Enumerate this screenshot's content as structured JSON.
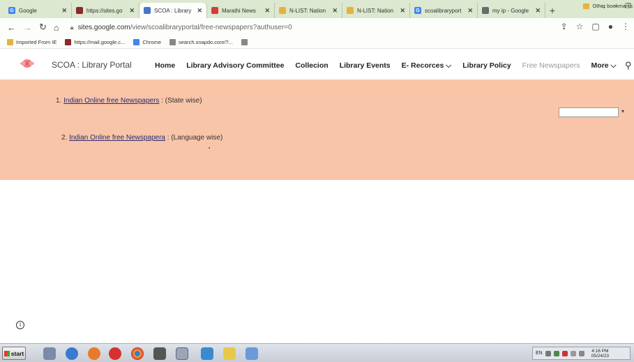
{
  "browser": {
    "tabs": [
      {
        "title": "Google",
        "icon": "google-icon",
        "color": "#4285f4",
        "glyph": "G",
        "active": false
      },
      {
        "title": "https://sites.go",
        "icon": "library-logo-icon",
        "color": "#8b2a2a",
        "glyph": "",
        "active": false
      },
      {
        "title": "SCOA : Library",
        "icon": "google-sites-icon",
        "color": "#4a76c9",
        "glyph": "",
        "active": true
      },
      {
        "title": "Marathi News",
        "icon": "news-icon",
        "color": "#d83a3a",
        "glyph": "",
        "active": false
      },
      {
        "title": "N-LIST: Nation",
        "icon": "nlist-icon",
        "color": "#e8b23a",
        "glyph": "",
        "active": false
      },
      {
        "title": "N-LIST: Nation",
        "icon": "nlist-icon",
        "color": "#e8b23a",
        "glyph": "",
        "active": false
      },
      {
        "title": "scoalibraryport",
        "icon": "google-icon",
        "color": "#4285f4",
        "glyph": "G",
        "active": false
      },
      {
        "title": "my ip - Google",
        "icon": "globe-icon",
        "color": "#6a6a6a",
        "glyph": "",
        "active": false
      }
    ],
    "address": {
      "host": "sites.google.com",
      "path": "/view/scoalibraryportal/free-newspapers?authuser=0"
    },
    "bookmarks": [
      {
        "label": "Imported From IE",
        "icon": "folder-icon",
        "color": "#e8b23a"
      },
      {
        "label": "https://mail.google.c...",
        "icon": "library-logo-icon",
        "color": "#8b2a2a"
      },
      {
        "label": "Chrome",
        "icon": "google-icon",
        "color": "#4285f4"
      },
      {
        "label": "search.snapdo.com/?...",
        "icon": "search-icon",
        "color": "#888888"
      },
      {
        "label": "",
        "icon": "search-icon",
        "color": "#888888"
      }
    ],
    "other_bookmarks": "Other bookmarks"
  },
  "site": {
    "title": "SCOA : Library Portal",
    "nav": [
      {
        "label": "Home",
        "current": false
      },
      {
        "label": "Library Advisory Committee",
        "current": false
      },
      {
        "label": "Collecion",
        "current": false
      },
      {
        "label": "Library Events",
        "current": false
      },
      {
        "label": "E- Recorces ⌵",
        "current": false
      },
      {
        "label": "Library Policy",
        "current": false
      },
      {
        "label": "Free Newspapers",
        "current": true
      },
      {
        "label": "More ⌵",
        "current": false
      }
    ],
    "content_bg": "#f8c5a9"
  },
  "content": {
    "item1": {
      "number": "1.",
      "link": "Indian Online free Newspapers",
      "suffix": " : (State wise)"
    },
    "item2": {
      "number": "2.",
      "link": "Indian Online free Newspapera",
      "suffix": " : (Language wise)"
    }
  },
  "taskbar": {
    "start_label": "start",
    "language": "EN",
    "time": "4:16 PM",
    "date": "05/24/23"
  }
}
